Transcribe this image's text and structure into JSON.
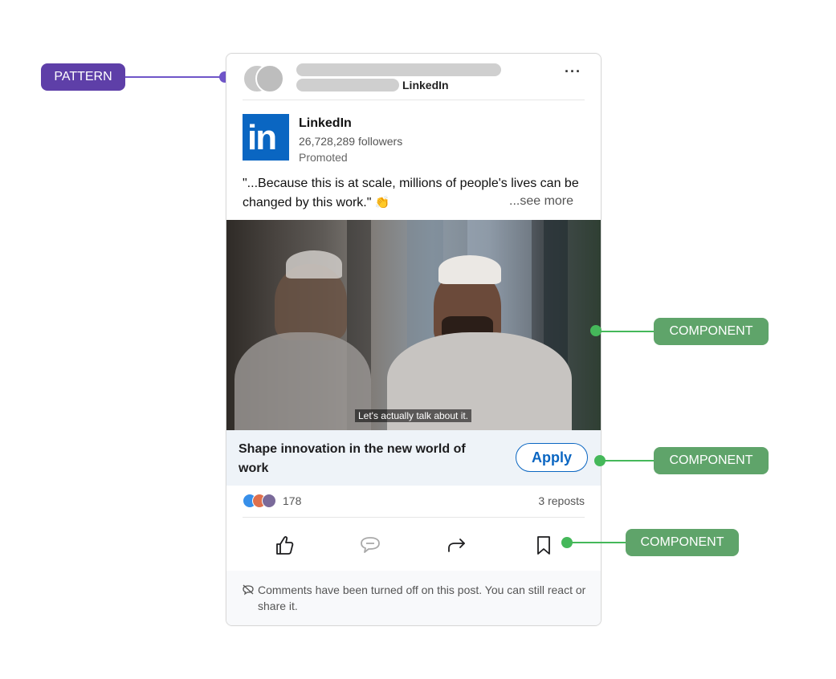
{
  "annotations": {
    "pattern": "PATTERN",
    "component_video": "COMPONENT",
    "component_cta": "COMPONENT",
    "component_actions": "COMPONENT"
  },
  "post": {
    "header_network_label": "LinkedIn",
    "more_label": "···",
    "company": "LinkedIn",
    "followers": "26,728,289 followers",
    "promoted": "Promoted",
    "text": "\"...Because this is at scale, millions of people's lives can be changed by this work.\"",
    "emoji": "👏",
    "see_more": "...see more",
    "logo_text": "in"
  },
  "media": {
    "subtitle": "Let's actually talk about it."
  },
  "cta": {
    "text": "Shape innovation in the new world of work",
    "button": "Apply"
  },
  "social": {
    "reaction_count": "178",
    "reposts": "3 reposts"
  },
  "actions": {
    "icons": [
      "like-icon",
      "comment-icon",
      "share-icon",
      "save-icon"
    ]
  },
  "notice": {
    "text": "Comments have been turned off on this post. You can still react or share it."
  },
  "colors": {
    "brand_blue": "#0a66c2",
    "pattern_purple": "#5e3fa8",
    "component_green": "#5fa46a"
  }
}
